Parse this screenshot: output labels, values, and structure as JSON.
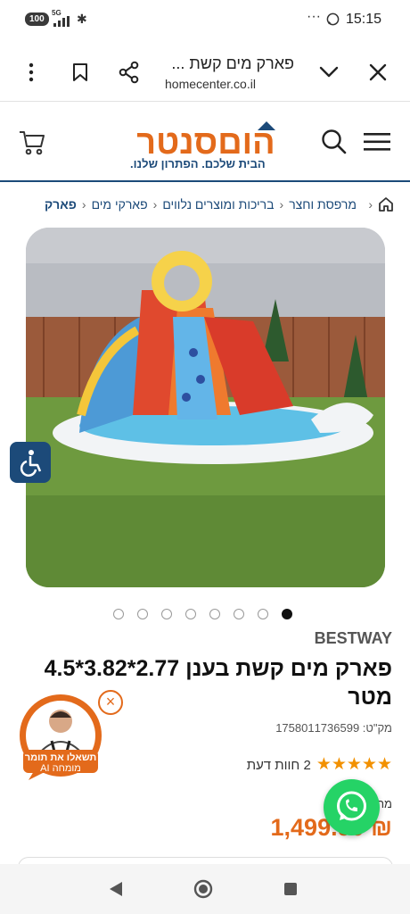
{
  "status_bar": {
    "battery": "100",
    "network": "5G",
    "time": "15:15",
    "more": "···"
  },
  "browser": {
    "page_title": "פארק מים קשת ...",
    "url": "homecenter.co.il"
  },
  "header": {
    "logo": "הוםסנטר",
    "tagline": "הבית שלכם. הפתרון שלנו."
  },
  "breadcrumb": [
    "מרפסת וחצר",
    "בריכות ומוצרים נלווים",
    "פארקי מים",
    "פארק"
  ],
  "carousel": {
    "count": 8,
    "active_index": 7
  },
  "product": {
    "brand": "BESTWAY",
    "title": "פארק מים קשת בענן 2.77*3.82*4.5 מטר",
    "sku": "מק\"ט: 1758011736599",
    "stars": "★★★★★",
    "reviews": "2 חוות דעת",
    "price_label": "מר",
    "price": "₪ 1,499.90"
  },
  "expert_badge": {
    "line1": "תשאלו את תומר",
    "line2": "מומחה AI"
  },
  "colors": {
    "brand_blue": "#1c4a79",
    "brand_orange": "#e36a1b",
    "star": "#f29100",
    "whatsapp": "#25d366"
  }
}
